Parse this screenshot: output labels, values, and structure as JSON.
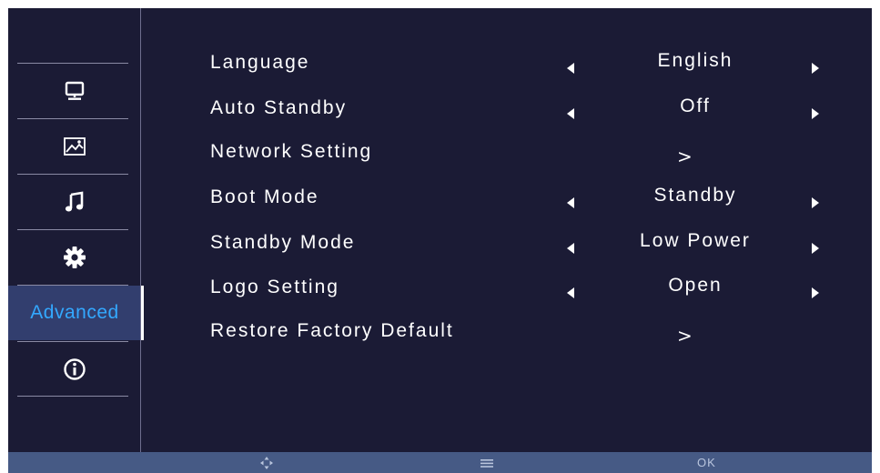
{
  "sidebar": {
    "items": [
      {
        "icon": "monitor-icon"
      },
      {
        "icon": "picture-icon"
      },
      {
        "icon": "music-note-icon"
      },
      {
        "icon": "gear-icon"
      },
      {
        "label": "Advanced",
        "active": true
      },
      {
        "icon": "info-icon"
      }
    ]
  },
  "menu": {
    "rows": [
      {
        "label": "Language",
        "value": "English",
        "type": "selector"
      },
      {
        "label": "Auto Standby",
        "value": "Off",
        "type": "selector"
      },
      {
        "label": "Network Setting",
        "chevron": ">",
        "type": "submenu"
      },
      {
        "label": "Boot Mode",
        "value": "Standby",
        "type": "selector"
      },
      {
        "label": "Standby Mode",
        "value": "Low Power",
        "type": "selector"
      },
      {
        "label": "Logo Setting",
        "value": "Open",
        "type": "selector"
      },
      {
        "label": "Restore Factory Default",
        "chevron": ">",
        "type": "submenu"
      }
    ]
  },
  "hint_bar": {
    "navigate_icon": "dpad-arrows-icon",
    "menu_icon": "menu-lines-icon",
    "ok_label": "OK"
  },
  "colors": {
    "background": "#1b1b35",
    "active_item_bg": "#323e6e",
    "active_text": "#33a8ff",
    "hint_bar": "#465a85"
  }
}
